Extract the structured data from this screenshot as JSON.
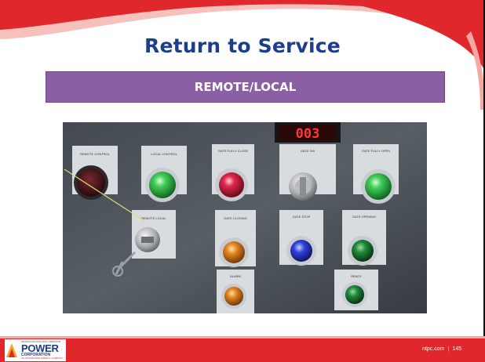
{
  "slide": {
    "title": "Return to Service",
    "banner": "REMOTE/LOCAL",
    "footer": {
      "site": "ntpc.com",
      "separator": "|",
      "page_number": "145"
    }
  },
  "panel_photo": {
    "display_readout": "003",
    "labels": {
      "remote_control": "REMOTE CONTROL",
      "local_control": "LOCAL CONTROL",
      "gate_fully_close": "GATE FULLY CLOSE",
      "gate_sw": "GATE SW",
      "gate_fully_open": "GATE FULLY OPEN",
      "remote_local": "REMOTE LOCAL",
      "gate_closing": "GATE CLOSING",
      "gate_stop": "GATE STOP",
      "gate_opening": "GATE OPENING",
      "alarm": "ALARM",
      "ready": "READY"
    }
  },
  "logo": {
    "top": "NEWFOUNDLAND AND LABRADOR",
    "main": "POWER",
    "sub": "CORPORATION",
    "tag": "AN INTEGRATED ENERGY COMPANY"
  },
  "colors": {
    "title": "#1f3e8a",
    "banner": "#8a5fa3",
    "accent_red": "#e0272b",
    "swoosh_pink": "#f6a7a2"
  }
}
